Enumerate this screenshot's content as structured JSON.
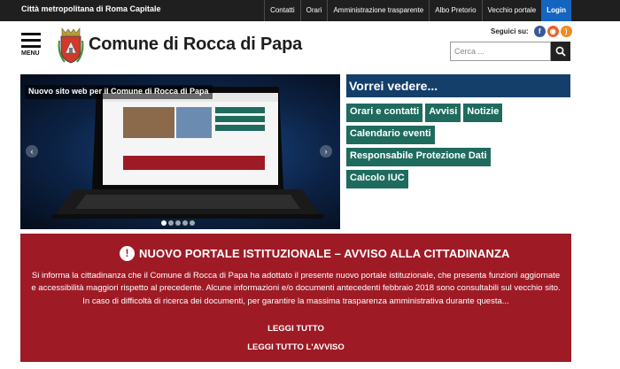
{
  "topbar": {
    "brand": "Città metropolitana di Roma Capitale",
    "nav": [
      "Contatti",
      "Orari",
      "Amministrazione trasparente",
      "Albo Pretorio",
      "Vecchio portale"
    ],
    "login": "Login"
  },
  "header": {
    "menu_label": "MENU",
    "site_title": "Comune di Rocca di Papa",
    "social_label": "Seguici su:",
    "search_placeholder": "Cerca ..."
  },
  "slider": {
    "caption": "Nuovo sito web per il Comune di Rocca di Papa",
    "slide_count": 5,
    "active_slide": 1
  },
  "quicklinks": {
    "title": "Vorrei vedere...",
    "rows": [
      [
        "Orari e contatti",
        "Avvisi",
        "Notizie"
      ],
      [
        "Calendario eventi"
      ],
      [
        "Responsabile Protezione Dati"
      ],
      [
        "Calcolo IUC"
      ]
    ]
  },
  "notice": {
    "title": "NUOVO PORTALE ISTITUZIONALE – AVVISO ALLA CITTADINANZA",
    "body": "Si informa la cittadinanza che il Comune di Rocca di Papa ha adottato il presente nuovo portale istituzionale, che presenta funzioni aggiornate e accessibilità maggiori rispetto al precedente. Alcune informazioni e/o documenti antecedenti febbraio 2018 sono consultabili sul vecchio sito. In caso di difficoltà di ricerca dei documenti, per garantire la massima trasparenza amministrativa durante questa...",
    "read_more": "LEGGI TUTTO",
    "read_all": "LEGGI TUTTO L'AVVISO"
  },
  "colors": {
    "topbar": "#1f1f1f",
    "login": "#1565c0",
    "vorrei": "#143f6b",
    "quicklink": "#1f6b5e",
    "notice": "#9e1b26"
  }
}
